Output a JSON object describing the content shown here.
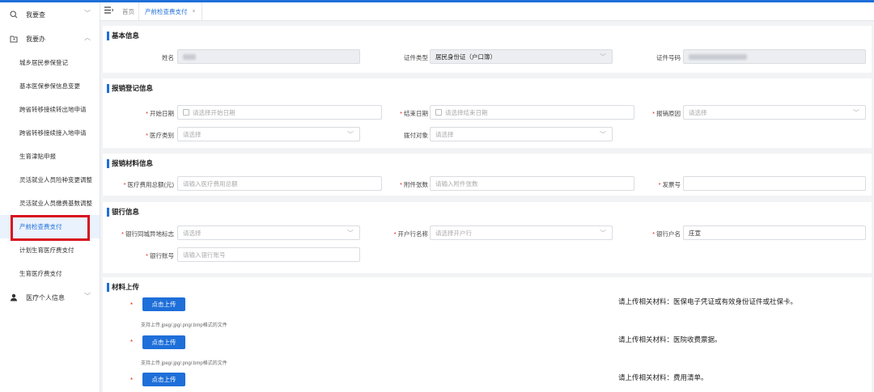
{
  "sidebar": {
    "groups": [
      {
        "label": "我要查"
      },
      {
        "label": "我要办"
      },
      {
        "label": "医疗个人信息"
      }
    ],
    "items": [
      {
        "label": "城乡居民参保登记"
      },
      {
        "label": "基本医保参保信息变更"
      },
      {
        "label": "跨省转移接续转出地申请"
      },
      {
        "label": "跨省转移接续接入地申请"
      },
      {
        "label": "生育津贴申报"
      },
      {
        "label": "灵活就业人员险种变更调整"
      },
      {
        "label": "灵活就业人员缴费基数调整"
      },
      {
        "label": "产前检查费支付"
      },
      {
        "label": "计划生育医疗费支付"
      },
      {
        "label": "生育医疗费支付"
      }
    ]
  },
  "tabs": {
    "home": "首页",
    "active": "产前检查费支付",
    "close": "×"
  },
  "basic": {
    "title": "基本信息",
    "name_label": "姓名",
    "idtype_label": "证件类型",
    "idtype_value": "居民身份证（户口簿）",
    "idno_label": "证件号码"
  },
  "reg": {
    "title": "报销登记信息",
    "start_label": "开始日期",
    "start_ph": "请选择开始日期",
    "end_label": "结束日期",
    "end_ph": "请选择结束日期",
    "reason_label": "报销原因",
    "reason_ph": "请选择",
    "medtype_label": "医疗类别",
    "medtype_ph": "请选择",
    "payee_label": "拨付对象",
    "payee_ph": "请选择"
  },
  "mat": {
    "title": "报销材料信息",
    "total_label": "医疗费用总额(元)",
    "total_ph": "请输入医疗费用总额",
    "attach_label": "附件张数",
    "attach_ph": "请输入附件张数",
    "invoice_label": "发票号"
  },
  "bank": {
    "title": "银行信息",
    "samecity_label": "银行同城异地标志",
    "samecity_ph": "请选择",
    "branch_label": "开户行名称",
    "branch_ph": "请选择开户行",
    "acctname_label": "银行户名",
    "acctname_value": "庄宣",
    "acctno_label": "银行账号",
    "acctno_ph": "请输入银行账号"
  },
  "upload": {
    "title": "材料上传",
    "star": "*",
    "button": "点击上传",
    "hint": "支持上传.jpeg/.jpg/.png/.bmp格式的文件",
    "materials": [
      "请上传相关材料：医保电子凭证或有效身份证件或社保卡。",
      "请上传相关材料：医院收费票据。",
      "请上传相关材料：费用清单。"
    ]
  }
}
